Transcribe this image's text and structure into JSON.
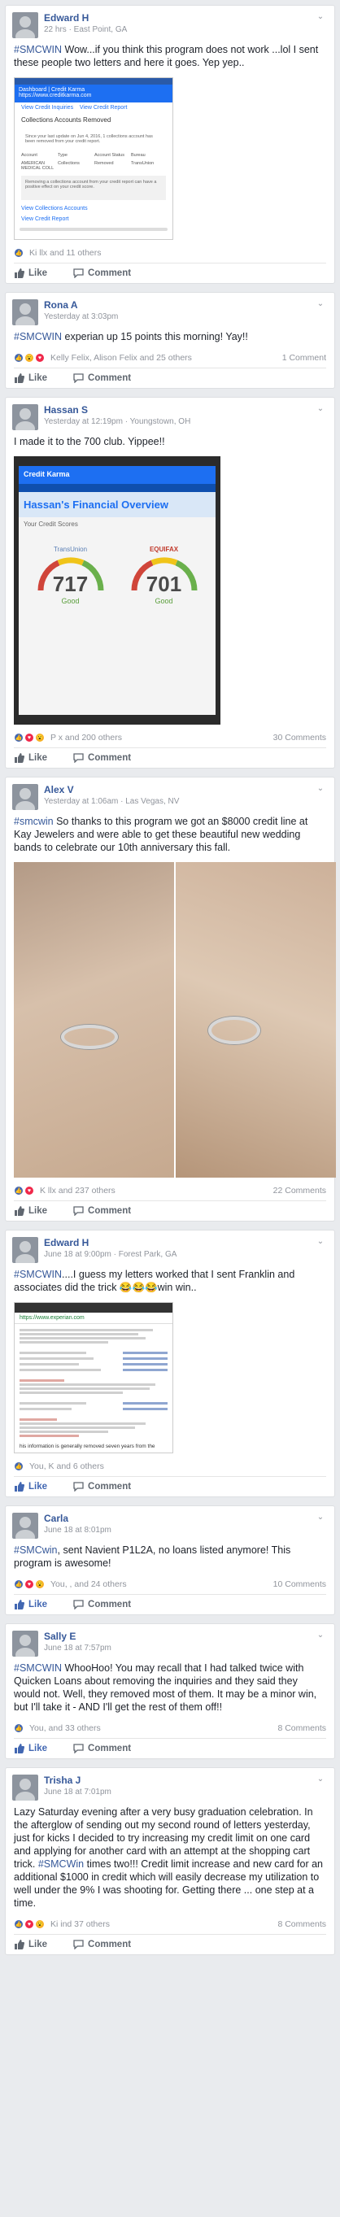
{
  "colors": {
    "accent": "#365899",
    "like": "#4267b2",
    "love": "#f0284a",
    "wow": "#f7b125"
  },
  "actions": {
    "like_label": "Like",
    "comment_label": "Comment"
  },
  "posts": [
    {
      "author": "Edward H",
      "meta": "22 hrs · East Point, GA",
      "tag": "#SMCWIN",
      "text": " Wow...if you think this program does not work ...lol I sent these people two letters and here it goes. Yep yep..",
      "shot": {
        "bar": "Dashboard | Credit Karma",
        "url": "https://www.creditkarma.com",
        "link1": "View Credit Inquiries",
        "link2": "View Credit Report",
        "heading": "Collections Accounts Removed",
        "para": "Since your last update on Jun 4, 2016, 1 collections account has been removed from your credit report.",
        "cols": [
          "Account",
          "Type",
          "Account Status",
          "Bureau"
        ],
        "row": [
          "AMERICAN MEDICAL COLL",
          "Collections",
          "Removed",
          "TransUnion"
        ],
        "note": "Removing a collections account from your credit report can have a positive effect on your credit score.",
        "link3": "View Collections Accounts",
        "link4": "View Credit Report"
      },
      "reactions": "Ki                    llx and 11 others",
      "comments": ""
    },
    {
      "author": "Rona A",
      "meta": "Yesterday at 3:03pm",
      "tag": "#SMCWIN",
      "text": " experian up 15 points this morning! Yay!!",
      "reactions": "Kelly Felix, Alison Felix and 25 others",
      "comments": "1 Comment"
    },
    {
      "author": "Hassan S",
      "meta": "Yesterday at 12:19pm · Youngstown, OH",
      "tag": "",
      "text": "I made it to the 700 club. Yippee!!",
      "score": {
        "brand": "Credit Karma",
        "title": "Hassan's Financial Overview",
        "label": "Your Credit Scores",
        "left_bureau": "TransUnion",
        "left_score": "717",
        "left_word": "Good",
        "right_bureau": "EQUIFAX",
        "right_score": "701",
        "right_word": "Good"
      },
      "reactions": "P                  x and 200 others",
      "comments": "30 Comments"
    },
    {
      "author": "Alex V",
      "meta": "Yesterday at 1:06am · Las Vegas, NV",
      "tag": "#smcwin",
      "text": " So thanks to this program we got an $8000 credit line at Kay Jewelers and were able to get these beautiful new wedding bands to celebrate our 10th anniversary this fall.",
      "reactions": "K                   llx and 237 others",
      "comments": "22 Comments"
    },
    {
      "author": "Edward H",
      "meta": "June 18 at 9:00pm · Forest Park, GA",
      "tag": "#SMCWIN",
      "text": "....I guess my letters worked that I sent Franklin and associates did the trick 😂😂😂win win..",
      "doc": {
        "url": "https://www.experian.com",
        "footer": "his information is generally removed seven years from the"
      },
      "reactions": "You, K                   and 6 others",
      "comments": ""
    },
    {
      "author": "Carla",
      "meta": "June 18 at 8:01pm",
      "tag": "#SMCwin",
      "text": ", sent Navient P1L2A, no loans listed anymore! This program is awesome!",
      "reactions": "You,           ,          and 24 others",
      "comments": "10 Comments"
    },
    {
      "author": "Sally E",
      "meta": "June 18 at 7:57pm",
      "tag": "#SMCWIN",
      "text": " WhooHoo! You may recall that I had talked twice with Quicken Loans about removing the inquiries and they said they would not. Well, they removed most of them. It may be a minor win, but I'll take it - AND I'll get the rest of them off!!",
      "reactions": "You,                    and 33 others",
      "comments": "8 Comments"
    },
    {
      "author": "Trisha J",
      "meta": "June 18 at 7:01pm",
      "tag": "#SMCWin",
      "text_before": "Lazy Saturday evening after a very busy graduation celebration. In the afterglow of sending out my second round of letters yesterday, just for kicks I decided to try increasing my credit limit on one card and applying for another card with an attempt at the shopping cart trick. ",
      "text": " times two!!! Credit limit increase and new card for an additional $1000 in credit which will easily decrease my utilization to well under the 9% I was shooting for. Getting there ... one step at a time.",
      "reactions": "Ki                 ind 37 others",
      "comments": "8 Comments"
    }
  ]
}
